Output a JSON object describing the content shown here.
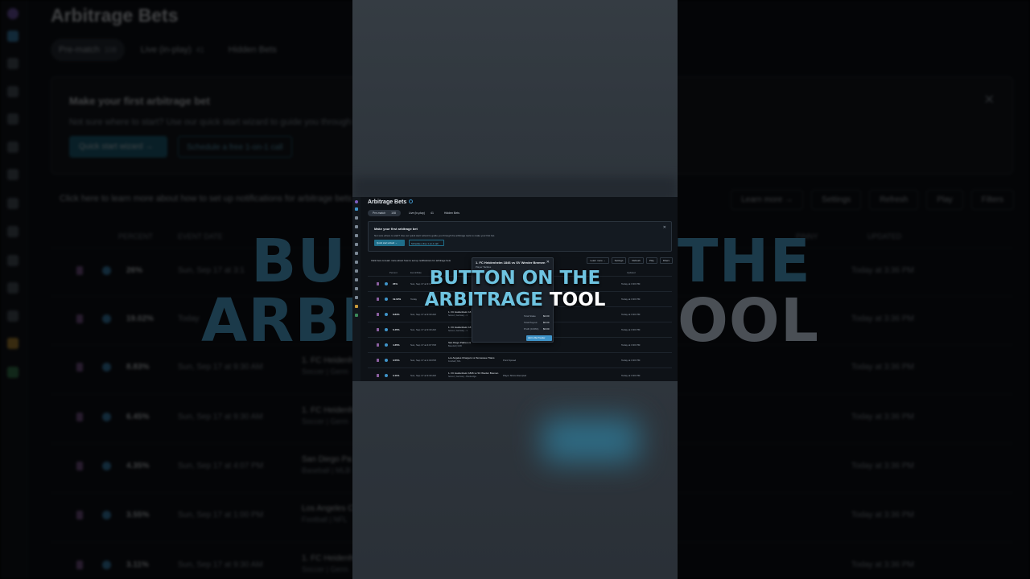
{
  "caption": {
    "line1": "BUTTON ON THE",
    "line2_highlight": "ARBITRAGE",
    "line2_white": "TOOL",
    "ghost_left": "BU",
    "ghost_left2": "ARBI",
    "ghost_right": "THE",
    "ghost_right2": "OOL",
    "highlight_color": "#6ec3e0"
  },
  "app": {
    "title": "Arbitrage Bets",
    "tabs": [
      {
        "label": "Pre-match",
        "count": "108"
      },
      {
        "label": "Live (in-play)",
        "count": "41"
      },
      {
        "label": "Hidden Bets",
        "count": ""
      }
    ],
    "onboarding": {
      "heading": "Make your first arbitrage bet",
      "text": "Not sure where to start? Use our quick start wizard to guide you through the arbitrage tools to make your first bet.",
      "text_short": "Not sure where to start? Use our quick start wizard to guide you through the arbi",
      "primary_button": "Quick start wizard →",
      "secondary_button": "Schedule a free 1-on-1 call",
      "close": "✕"
    },
    "notification_link": "Click here to learn more about how to set up notifications for arbitrage bets",
    "learn_more": "Learn more →",
    "actions": {
      "settings": "Settings",
      "refresh": "Refresh",
      "play": "Play",
      "filters": "Filters"
    },
    "columns": {
      "percent": "PERCENT",
      "event_date": "EVENT DATE",
      "pinny": "PINNY",
      "updated": "UPDATED"
    },
    "columns_small": {
      "percent": "Percent",
      "event": "Event/Date",
      "books": "Books",
      "updated": "Updated"
    },
    "rows": [
      {
        "percent": "26%",
        "date": "Sun, Sep 17 at 3:11 AM",
        "event": "",
        "league": "",
        "market": "",
        "updated": "Today at 3:36 PM"
      },
      {
        "percent": "19.02%",
        "date": "Today",
        "event": "",
        "league": "",
        "market": "",
        "updated": "Today at 3:36 PM"
      },
      {
        "percent": "8.83%",
        "date": "Sun, Sep 17 at 9:30 AM",
        "event": "1. FC Heidenheim 18",
        "league": "Soccer | Germany - 1",
        "market": "",
        "updated": "Today at 3:36 PM"
      },
      {
        "percent": "6.45%",
        "date": "Sun, Sep 17 at 9:30 AM",
        "event": "1. FC Heidenheim 18",
        "league": "Soccer | Germany - 1",
        "market": "",
        "updated": "Today at 3:36 PM"
      },
      {
        "percent": "4.35%",
        "date": "Sun, Sep 17 at 4:07 PM",
        "event": "San Diego Padres vs",
        "league": "Baseball | MLB",
        "market": "",
        "updated": "Today at 3:36 PM"
      },
      {
        "percent": "3.55%",
        "date": "Sun, Sep 17 at 1:00 PM",
        "event": "Los Angeles Chargers vs Tennessee Titans",
        "league": "Football | NFL",
        "market": "Point Spread",
        "updated": "Today at 3:36 PM"
      },
      {
        "percent": "3.11%",
        "date": "Sun, Sep 17 at 9:30 AM",
        "event": "1. FC Heidenheim 1846 vs SV Werder Bremen",
        "league": "Soccer | Germany - Bundesliga",
        "market": "Player Shots Attempted",
        "updated": "Today at 3:36 PM"
      }
    ],
    "bg_rows": [
      {
        "percent": "26%",
        "date": "Sun, Sep 17 at 3:1",
        "event": "",
        "league": ""
      },
      {
        "percent": "19.02%",
        "date": "Today",
        "event": "",
        "league": ""
      },
      {
        "percent": "8.83%",
        "date": "Sun, Sep 17 at 9:30 AM",
        "event": "1. FC Heidenhe",
        "league": "Soccer | Germ"
      },
      {
        "percent": "6.45%",
        "date": "Sun, Sep 17 at 9:30 AM",
        "event": "1. FC Heidenhe",
        "league": "Soccer | Germ"
      },
      {
        "percent": "4.35%",
        "date": "Sun, Sep 17 at 4:07 PM",
        "event": "San Diego Pa",
        "league": "Baseball | MLB"
      },
      {
        "percent": "3.55%",
        "date": "Sun, Sep 17 at 1:00 PM",
        "event": "Los Angeles C",
        "league": "Football | NFL"
      },
      {
        "percent": "3.11%",
        "date": "Sun, Sep 17 at 9:30 AM",
        "event": "1. FC Heidenhe",
        "league": "Soccer | Germ"
      }
    ],
    "popup": {
      "title": "1. FC Heidenheim 1846 vs SV Werder Bremen",
      "subtitle": "Player Tackles",
      "close": "✕",
      "total_stake_label": "Total Stake",
      "total_stake": "$0.00",
      "total_payout_label": "Total Payout",
      "total_payout": "$0.00",
      "profit_label": "Profit (0.00%)",
      "profit": "$0.00",
      "add_button": "Add to Bet Tracker"
    }
  }
}
